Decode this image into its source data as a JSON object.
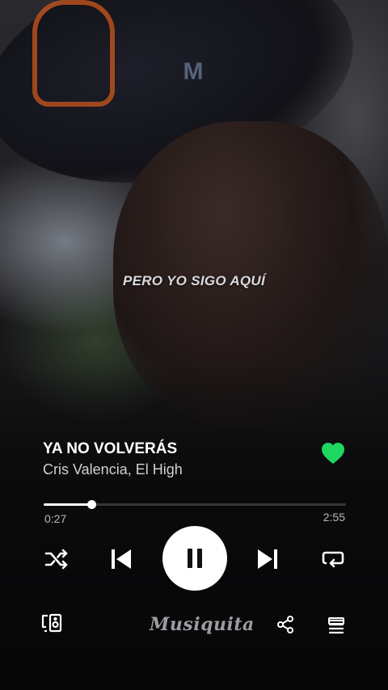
{
  "lyric": "PERO YO SIGO AQUÍ",
  "track": {
    "title": "YA NO VOLVERÁS",
    "artist": "Cris Valencia, El High",
    "liked": true,
    "progress_fraction": 0.157,
    "elapsed": "0:27",
    "duration": "2:55"
  },
  "controls": {
    "shuffle_icon": "shuffle-icon",
    "previous_icon": "skip-previous-icon",
    "play_state_icon": "pause-icon",
    "next_icon": "skip-next-icon",
    "repeat_icon": "repeat-icon"
  },
  "bottom_bar": {
    "devices_icon": "connect-device-icon",
    "brand": "Musiquita",
    "share_icon": "share-icon",
    "queue_icon": "queue-icon"
  },
  "colors": {
    "heart": "#1ed760",
    "text_primary": "#ffffff",
    "text_secondary": "#d0d0d4"
  }
}
